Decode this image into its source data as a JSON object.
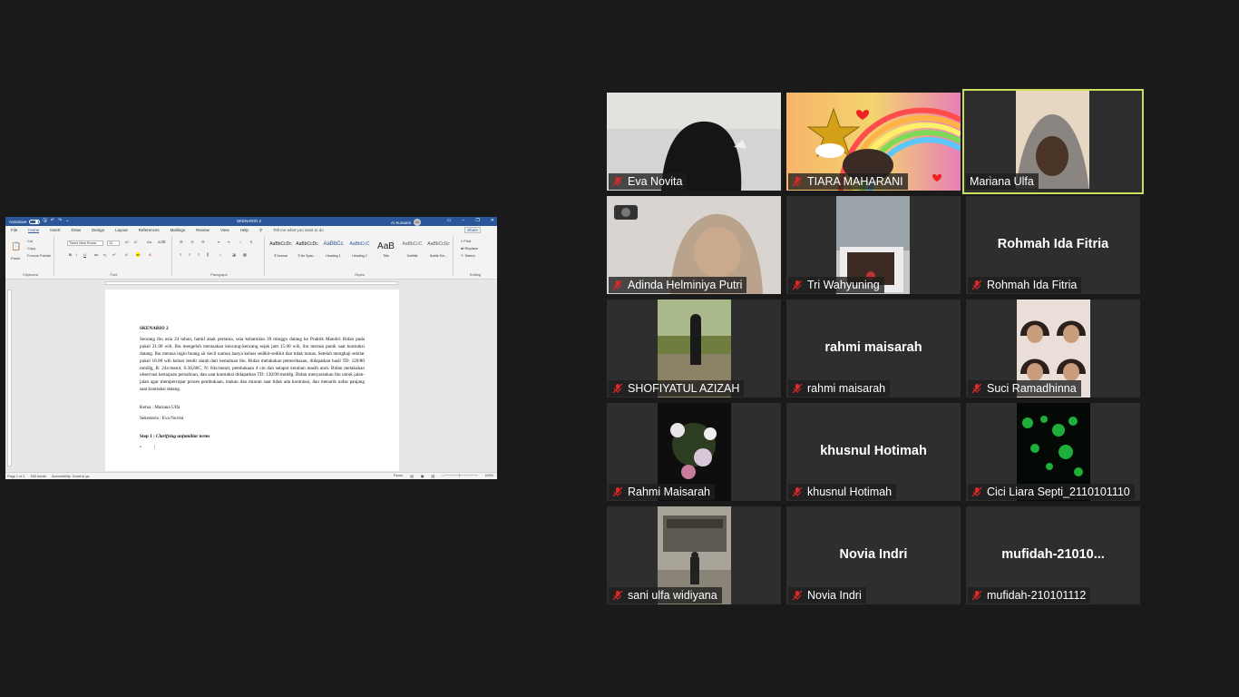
{
  "word": {
    "title_bar": {
      "autosave_label": "AutoSave",
      "autosave_state": "Off",
      "doc_name": "SKENARIO 2",
      "user_name": "Ai Sumarni",
      "user_initials": "AS"
    },
    "tabs": [
      "File",
      "Home",
      "Insert",
      "Draw",
      "Design",
      "Layout",
      "References",
      "Mailings",
      "Review",
      "View",
      "Help"
    ],
    "active_tab": "Home",
    "tell_me": "Tell me what you want to do",
    "share": "Share",
    "ribbon": {
      "clipboard": {
        "paste": "Paste",
        "cut": "Cut",
        "copy": "Copy",
        "format_painter": "Format Painter",
        "label": "Clipboard"
      },
      "font": {
        "family": "Times New Roma",
        "size": "12",
        "label": "Font"
      },
      "paragraph_label": "Paragraph",
      "styles": [
        {
          "preview": "AaBbCcDc",
          "name": "¶ Normal"
        },
        {
          "preview": "AaBbCcDc",
          "name": "¶ No Spac..."
        },
        {
          "preview": "AaBbCc",
          "name": "Heading 1"
        },
        {
          "preview": "AaBbCcC",
          "name": "Heading 2"
        },
        {
          "preview": "AaB",
          "name": "Title"
        },
        {
          "preview": "AaBbCcC",
          "name": "Subtitle"
        },
        {
          "preview": "AaBbCcDc",
          "name": "Subtle Em..."
        }
      ],
      "styles_label": "Styles",
      "editing": {
        "find": "Find",
        "replace": "Replace",
        "select": "Select",
        "label": "Editing"
      }
    },
    "document": {
      "title": "SKENARIO 2",
      "body": "Seorang ibu usia 24 tahun, hamil anak pertama, usia kehamilan 39 minggu datang ke Praktik Mandiri Bidan pada pukul 21.00 wib. Ibu mengeluh merasakan kencang-kencang sejak jam 15.00 wib, ibu merasa panik saat kontraksi datang. Ibu merasa ingin buang air kecil namun hanya keluar sedikit-sedikit dan tidak tuntas. Setelah mengkaji sekitar pukul 18.00 wib keluar lendir darah dari kemaluan ibu. Bidan melakukan pemeriksaan, didapatkan hasil TD: 120/80 mmHg, R: 24x/menit, S:36,60C, N: 84x/menit, pembukaan 4 cm dan selaput ketuban masih utuh. Bidan melakukan observasi kemajuan persalinan, dan saat kontraksi didapatkan TD: 130/90 mmHg. Bidan menyarankan ibu untuk jalan-jalan agar mempercepat proses pembukaan, makan dan minum saat tidak ada kontraksi, dan menarik nafas panjang saat kontraksi datang.",
      "ketua": "Ketua : Mariana Ulfa",
      "sekretaris": "Sekretaris : Eva Novita",
      "step_prefix": "Step 1 : ",
      "step_title": "Clarifying unfamiliar terms",
      "bullet": "•"
    },
    "status": {
      "page": "Page 1 of 1",
      "words": "155 words",
      "accessibility": "Accessibility: Good to go",
      "focus": "Focus",
      "zoom": "100%"
    }
  },
  "participants": [
    {
      "name": "Eva Novita",
      "label": "",
      "muted": true,
      "video": true,
      "speaking": false
    },
    {
      "name": "TIARA MAHARANI",
      "label": "",
      "muted": true,
      "video": true,
      "speaking": false
    },
    {
      "name": "Mariana Ulfa",
      "label": "",
      "muted": false,
      "video": true,
      "speaking": true
    },
    {
      "name": "Adinda Helminiya Putri",
      "label": "",
      "muted": true,
      "video": true,
      "speaking": false
    },
    {
      "name": "Tri Wahyuning",
      "label": "",
      "muted": true,
      "video": true,
      "speaking": false
    },
    {
      "name": "Rohmah Ida Fitria",
      "label": "Rohmah Ida Fitria",
      "muted": true,
      "video": false,
      "speaking": false
    },
    {
      "name": "SHOFIYATUL AZIZAH",
      "label": "",
      "muted": true,
      "video": true,
      "speaking": false
    },
    {
      "name": "rahmi maisarah",
      "label": "rahmi maisarah",
      "muted": true,
      "video": false,
      "speaking": false
    },
    {
      "name": "Suci Ramadhinna",
      "label": "",
      "muted": true,
      "video": true,
      "speaking": false
    },
    {
      "name": "Rahmi Maisarah",
      "label": "",
      "muted": true,
      "video": true,
      "speaking": false
    },
    {
      "name": "khusnul Hotimah",
      "label": "khusnul Hotimah",
      "muted": true,
      "video": false,
      "speaking": false
    },
    {
      "name": "Cici Liara Septi_2110101110",
      "label": "",
      "muted": true,
      "video": true,
      "speaking": false
    },
    {
      "name": "sani ulfa widiyana",
      "label": "",
      "muted": true,
      "video": true,
      "speaking": false
    },
    {
      "name": "Novia Indri",
      "label": "Novia Indri",
      "muted": true,
      "video": false,
      "speaking": false
    },
    {
      "name": "mufidah-210101112",
      "label": "mufidah-21010...",
      "muted": true,
      "video": false,
      "speaking": false
    }
  ],
  "colors": {
    "background": "#1a1a1a",
    "tile": "#2e2e2e",
    "speaker_border": "#cddc5d",
    "mute_icon": "#e02828",
    "word_blue": "#2b579a"
  }
}
